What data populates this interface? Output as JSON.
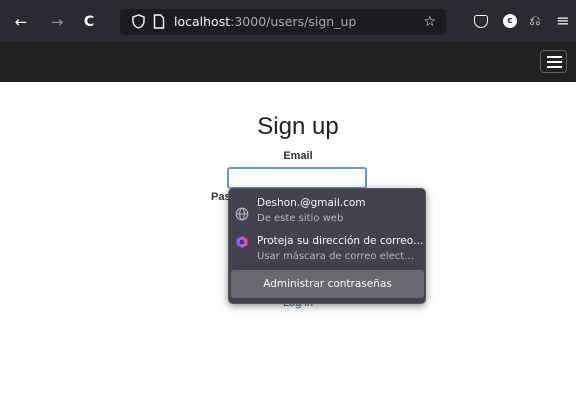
{
  "browser": {
    "url_host": "localhost",
    "url_path": ":3000/users/sign_up",
    "back_glyph": "←",
    "forward_glyph": "→",
    "reload_glyph": "C",
    "star_glyph": "☆",
    "menu_glyph": "≡",
    "account_initial": "c",
    "extension_glyph": "⎌"
  },
  "page": {
    "title": "Sign up",
    "email_label": "Email",
    "password_label": "Pas",
    "login_link": "Log in"
  },
  "autocomplete": {
    "items": [
      {
        "title": "Deshon.@gmail.com",
        "subtitle": "De este sitio web",
        "icon": "globe-icon"
      },
      {
        "title": "Proteja su dirección de correo…",
        "subtitle": "Usar máscara de correo elect…",
        "icon": "relay-mask-icon"
      }
    ],
    "footer": "Administrar contraseñas"
  },
  "colors": {
    "toolbar": "#2b2a33",
    "urlbar": "#1c1b22",
    "site_nav": "#212121",
    "popup": "#42414d",
    "popup_footer": "#6a6972",
    "focus_ring": "#5b9dd9",
    "link": "#2a6bc7",
    "relay_icon": "#9059ff"
  }
}
